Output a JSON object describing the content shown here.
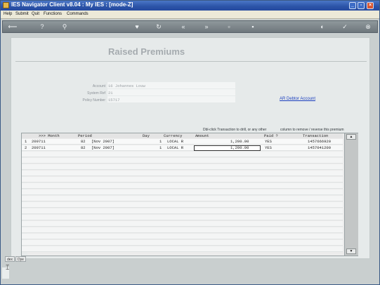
{
  "window": {
    "title": "IES Navigator Client v8.04 : My IES :      [mode-Z]"
  },
  "menu": [
    "Help",
    "Submit",
    "Quit",
    "Functions",
    "Commands"
  ],
  "toolbar": {
    "icons": [
      "back-arrow-icon",
      "help-icon",
      "search-icon",
      "heart-icon",
      "refresh-icon",
      "rewind-icon",
      "fast-forward-icon",
      "page-icon",
      "close-panel-icon",
      "run-icon",
      "check-icon",
      "close-icon"
    ]
  },
  "page": {
    "heading": "Raised Premiums",
    "fields": [
      {
        "label": "Account",
        "value": "16 Johannes Louw"
      },
      {
        "label": "System Ref",
        "value": "21"
      },
      {
        "label": "Policy Number",
        "value": "15717"
      }
    ],
    "link": "AR Debtor Account",
    "hint_left": "Dbl-click Transaction to drill, or any other",
    "hint_right": "column to remove / reverse this premium"
  },
  "grid": {
    "columns": [
      ">>> Month",
      "Period",
      "Day",
      "Currency",
      "Amount",
      "Paid ?",
      "Transaction"
    ],
    "rows": [
      {
        "n": "1",
        "month": "200711",
        "period_no": "82",
        "period_label": "[Nov 2007]",
        "day": "1",
        "currency": "LOCAL R",
        "amount": "1,200.00",
        "paid": "YES",
        "transaction": "1457666920"
      },
      {
        "n": "2",
        "month": "200711",
        "period_no": "82",
        "period_label": "[Nov 2007]",
        "day": "1",
        "currency": "LOCAL R",
        "amount": "1,200.00",
        "paid": "YES",
        "transaction": "1457041200"
      }
    ]
  },
  "tabs": [
    "dex",
    "Dye"
  ]
}
